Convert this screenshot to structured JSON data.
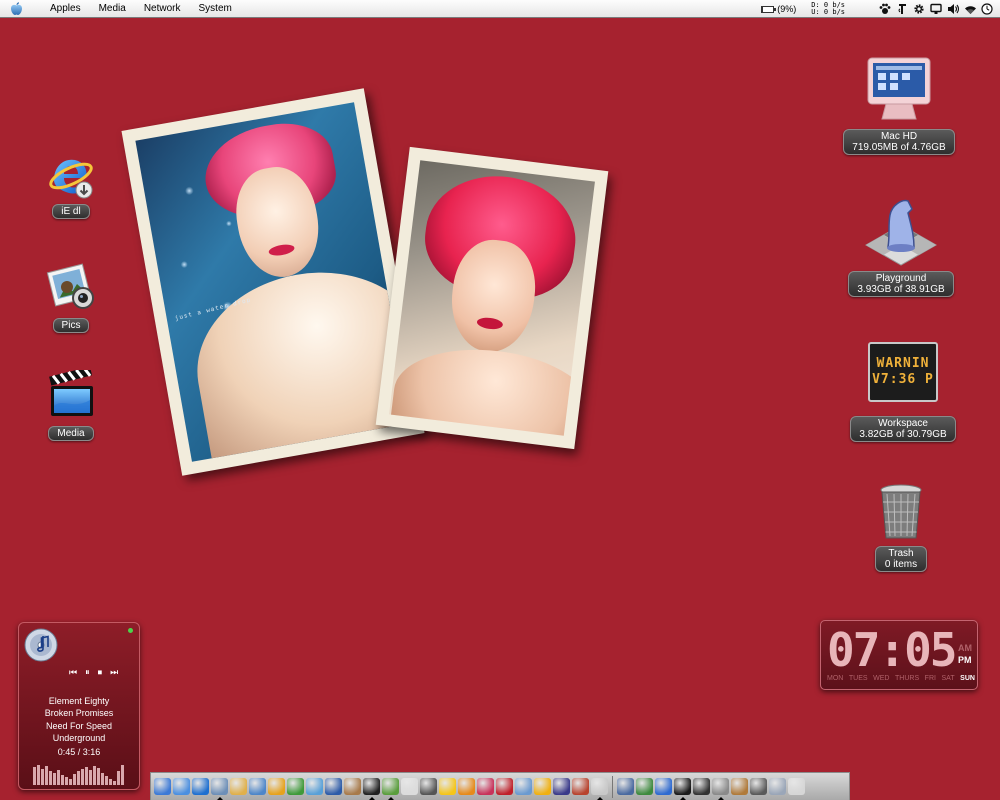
{
  "menubar": {
    "menus": [
      "Apples",
      "Media",
      "Network",
      "System"
    ],
    "battery_text": "(9%)",
    "battery_level": 0.09,
    "net_down": "D:  0 b/s",
    "net_up": "U:  0 b/s"
  },
  "desktop_icons_left": [
    {
      "label": "iE dl",
      "icon": "internet-explorer-icon"
    },
    {
      "label": "Pics",
      "icon": "iphoto-icon"
    },
    {
      "label": "Media",
      "icon": "clapperboard-icon"
    }
  ],
  "drives": {
    "machd": {
      "name": "Mac HD",
      "detail": "719.05MB of 4.76GB"
    },
    "playground": {
      "name": "Playground",
      "detail": "3.93GB of 38.91GB"
    },
    "workspace": {
      "name": "Workspace",
      "detail": "3.82GB of 30.79GB"
    },
    "trash": {
      "name": "Trash",
      "detail": "0 items"
    },
    "warning_sign": {
      "line1": "WARNIN",
      "line2": "V7:36 P"
    }
  },
  "photos": {
    "left_caption": "just a water drop"
  },
  "itunes": {
    "artist": "Element Eighty",
    "song": "Broken Promises",
    "album": "Need For Speed Underground",
    "elapsed": "0:45",
    "separator": "/",
    "total": "3:16",
    "progress": 0.23
  },
  "clock": {
    "time": "07:05",
    "am": "AM",
    "pm": "PM",
    "days": [
      "MON",
      "TUES",
      "WED",
      "THURS",
      "FRI",
      "SAT",
      "SUN"
    ],
    "active_day": "SUN"
  },
  "colors": {
    "desktop": "#a6222f",
    "widget": "#7f1a25",
    "accent_pink": "#e8457a"
  },
  "dock": {
    "items": [
      "finder-icon",
      "safari-icon",
      "internet-explorer-icon",
      "iphoto-icon",
      "notes-icon",
      "mail-icon",
      "runner-icon",
      "globe-icon",
      "network-icon",
      "clapperboard-icon",
      "mail-stamp-icon",
      "x11-icon",
      "itunes-icon",
      "document-icon",
      "target-icon",
      "checkbox-icon",
      "hand-icon",
      "pinwheel-icon",
      "hat-icon",
      "link-icon",
      "warning-icon",
      "shield-icon",
      "face-icon",
      "book-icon",
      "grid-icon",
      "photo-icon",
      "info-icon",
      "terminal-icon",
      "screen-icon",
      "palette-icon",
      "gear-icon",
      "disk-icon",
      "applications-icon",
      "home-icon"
    ]
  }
}
